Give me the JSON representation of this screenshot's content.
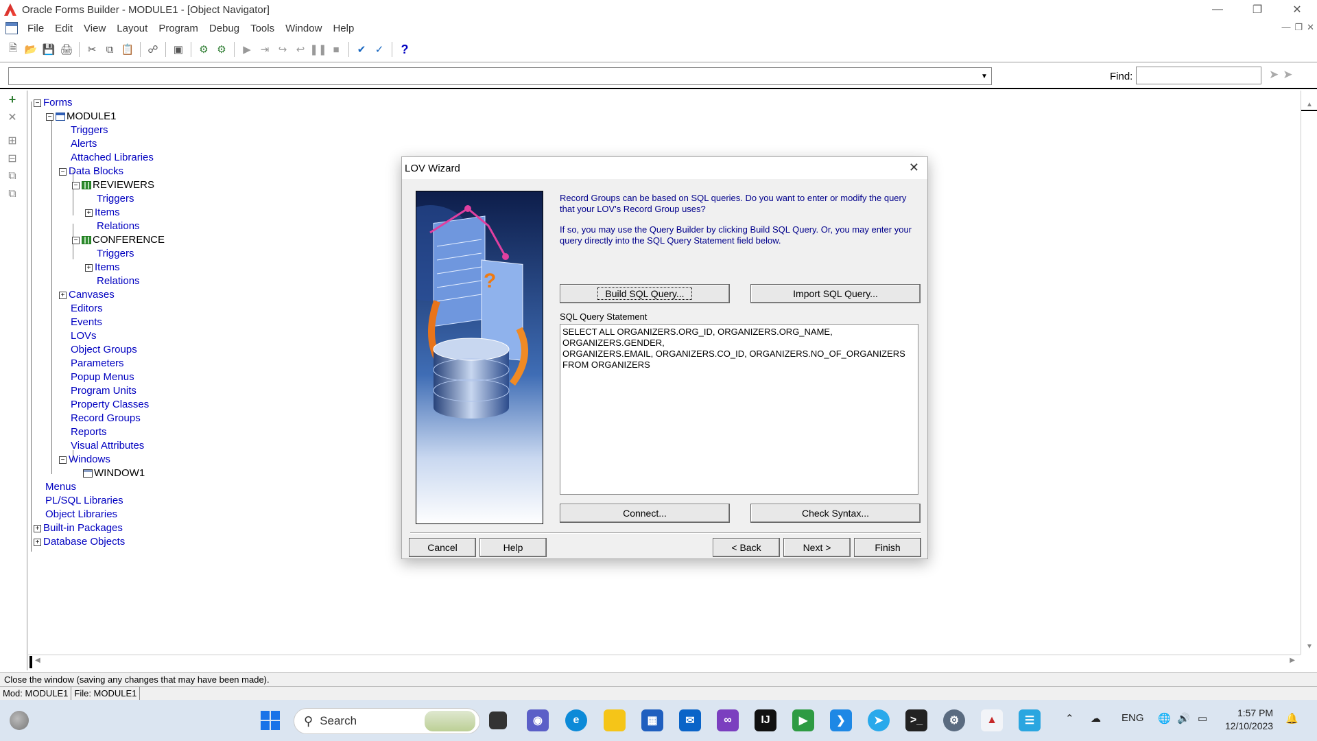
{
  "window": {
    "title": "Oracle Forms Builder - MODULE1 - [Object Navigator]"
  },
  "menu": [
    "File",
    "Edit",
    "View",
    "Layout",
    "Program",
    "Debug",
    "Tools",
    "Window",
    "Help"
  ],
  "find": {
    "label": "Find:",
    "value": ""
  },
  "tree": {
    "forms": "Forms",
    "module": "MODULE1",
    "triggers": "Triggers",
    "alerts": "Alerts",
    "attached_libraries": "Attached Libraries",
    "data_blocks": "Data Blocks",
    "reviewers": "REVIEWERS",
    "rev_triggers": "Triggers",
    "rev_items": "Items",
    "rev_relations": "Relations",
    "conference": "CONFERENCE",
    "conf_triggers": "Triggers",
    "conf_items": "Items",
    "conf_relations": "Relations",
    "canvases": "Canvases",
    "editors": "Editors",
    "events": "Events",
    "lovs": "LOVs",
    "object_groups": "Object Groups",
    "parameters": "Parameters",
    "popup_menus": "Popup Menus",
    "program_units": "Program Units",
    "property_classes": "Property Classes",
    "record_groups": "Record Groups",
    "reports": "Reports",
    "visual_attributes": "Visual Attributes",
    "windows": "Windows",
    "window1": "WINDOW1",
    "menus": "Menus",
    "plsql_libraries": "PL/SQL Libraries",
    "object_libraries": "Object Libraries",
    "builtin_packages": "Built-in Packages",
    "database_objects": "Database Objects"
  },
  "status": {
    "message": "Close the window (saving any changes that may have been made).",
    "mod": "Mod: MODULE1",
    "file": "File: MODULE1"
  },
  "dialog": {
    "title": "LOV Wizard",
    "para1": "Record Groups can be based on SQL queries. Do you want to enter or modify the query that your LOV's Record Group uses?",
    "para2": "If so, you may use the Query Builder by clicking Build SQL Query. Or, you may enter your query directly into the SQL Query Statement field below.",
    "build_btn": "Build SQL Query...",
    "import_btn": "Import SQL Query...",
    "sql_label": "SQL Query Statement",
    "sql_text": "SELECT ALL ORGANIZERS.ORG_ID, ORGANIZERS.ORG_NAME,\nORGANIZERS.GENDER,\nORGANIZERS.EMAIL, ORGANIZERS.CO_ID, ORGANIZERS.NO_OF_ORGANIZERS\nFROM ORGANIZERS",
    "connect_btn": "Connect...",
    "check_btn": "Check Syntax...",
    "cancel_btn": "Cancel",
    "help_btn": "Help",
    "back_btn": "< Back",
    "next_btn": "Next >",
    "finish_btn": "Finish"
  },
  "taskbar": {
    "search": "Search",
    "lang": "ENG",
    "time": "1:57 PM",
    "date": "12/10/2023"
  }
}
